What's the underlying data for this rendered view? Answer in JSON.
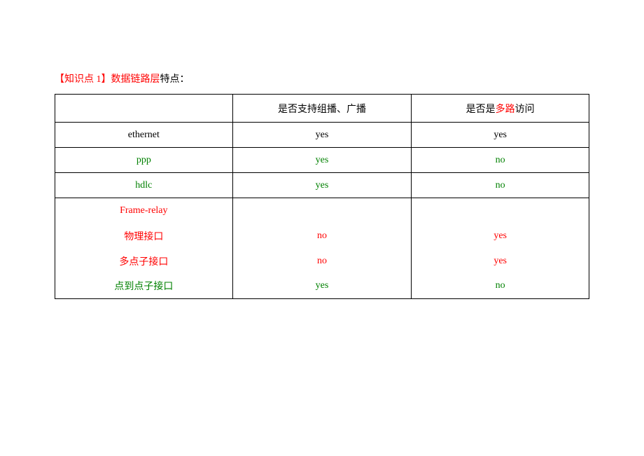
{
  "title": {
    "bracket_open": "【",
    "label_prefix": "知识点 1",
    "bracket_close": "】",
    "red_part": "数据链路层",
    "black_part": "特点："
  },
  "headers": {
    "col1": "",
    "col2": "是否支持组播、广播",
    "col3_before": "是否是",
    "col3_red": "多路",
    "col3_after": "访问"
  },
  "rows": {
    "ethernet": {
      "name": "ethernet",
      "c2": "yes",
      "c3": "yes"
    },
    "ppp": {
      "name": "ppp",
      "c2": "yes",
      "c3": "no"
    },
    "hdlc": {
      "name": "hdlc",
      "c2": "yes",
      "c3": "no"
    },
    "fr": {
      "name": "Frame-relay"
    },
    "fr_phys": {
      "name": "物理接口",
      "c2": "no",
      "c3": "yes"
    },
    "fr_multi": {
      "name": "多点子接口",
      "c2": "no",
      "c3": "yes"
    },
    "fr_p2p": {
      "name": "点到点子接口",
      "c2": "yes",
      "c3": "no"
    }
  }
}
